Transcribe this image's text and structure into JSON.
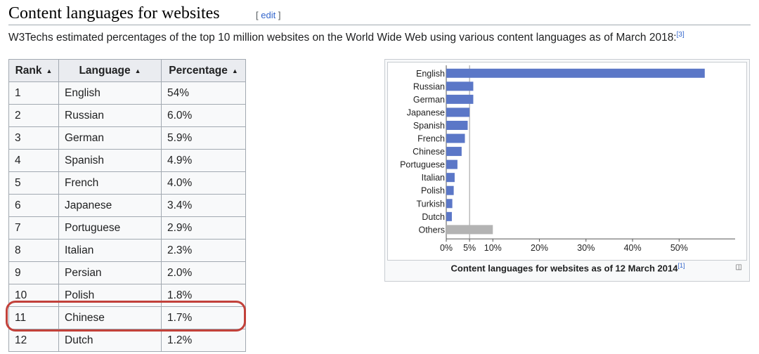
{
  "section": {
    "title": "Content languages for websites",
    "edit_open": "[ ",
    "edit_label": "edit",
    "edit_close": " ]"
  },
  "intro": {
    "text": "W3Techs estimated percentages of the top 10 million websites on the World Wide Web using various content languages as of March 2018:",
    "ref": "[3]"
  },
  "table": {
    "headers": [
      "Rank",
      "Language",
      "Percentage"
    ],
    "sort_icon": "sort-icon",
    "rows": [
      {
        "rank": "1",
        "language": "English",
        "percentage": "54%"
      },
      {
        "rank": "2",
        "language": "Russian",
        "percentage": "6.0%"
      },
      {
        "rank": "3",
        "language": "German",
        "percentage": "5.9%"
      },
      {
        "rank": "4",
        "language": "Spanish",
        "percentage": "4.9%"
      },
      {
        "rank": "5",
        "language": "French",
        "percentage": "4.0%"
      },
      {
        "rank": "6",
        "language": "Japanese",
        "percentage": "3.4%"
      },
      {
        "rank": "7",
        "language": "Portuguese",
        "percentage": "2.9%"
      },
      {
        "rank": "8",
        "language": "Italian",
        "percentage": "2.3%"
      },
      {
        "rank": "9",
        "language": "Persian",
        "percentage": "2.0%"
      },
      {
        "rank": "10",
        "language": "Polish",
        "percentage": "1.8%"
      },
      {
        "rank": "11",
        "language": "Chinese",
        "percentage": "1.7%"
      },
      {
        "rank": "12",
        "language": "Dutch",
        "percentage": "1.2%"
      }
    ],
    "highlight_row_rank": "11",
    "highlight_color": "#c2413a"
  },
  "figure": {
    "caption": "Content languages for websites as of 12 March 2014",
    "caption_ref": "[1]",
    "magnify_icon": "magnify-icon"
  },
  "chart_data": {
    "type": "bar",
    "orientation": "horizontal",
    "categories": [
      "English",
      "Russian",
      "German",
      "Japanese",
      "Spanish",
      "French",
      "Chinese",
      "Portuguese",
      "Italian",
      "Polish",
      "Turkish",
      "Dutch",
      "Others"
    ],
    "values": [
      55.5,
      5.8,
      5.8,
      5.0,
      4.6,
      4.0,
      3.3,
      2.4,
      1.8,
      1.6,
      1.3,
      1.2,
      10.0
    ],
    "colors": [
      "#5b77c7",
      "#5b77c7",
      "#5b77c7",
      "#5b77c7",
      "#5b77c7",
      "#5b77c7",
      "#5b77c7",
      "#5b77c7",
      "#5b77c7",
      "#5b77c7",
      "#5b77c7",
      "#5b77c7",
      "#b3b3b3"
    ],
    "xticks": [
      "0%",
      "5%",
      "10%",
      "20%",
      "30%",
      "40%",
      "50%"
    ],
    "xtick_values": [
      0,
      5,
      10,
      20,
      30,
      40,
      50
    ],
    "xlim": [
      0,
      59
    ],
    "reference_line": 5,
    "title": "Content languages for websites as of 12 March 2014"
  }
}
